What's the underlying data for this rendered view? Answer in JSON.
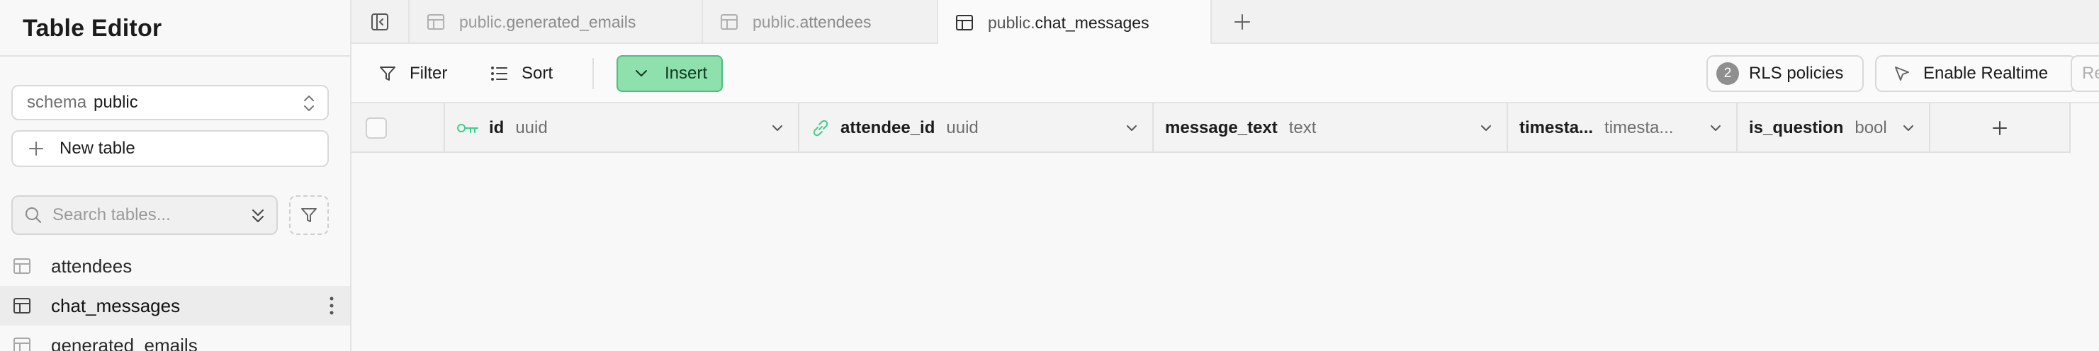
{
  "sidebar": {
    "title": "Table Editor",
    "schema": {
      "prefix": "schema",
      "value": "public"
    },
    "new_table_label": "New table",
    "search": {
      "placeholder": "Search tables..."
    },
    "tables": [
      {
        "name": "attendees",
        "active": false
      },
      {
        "name": "chat_messages",
        "active": true
      },
      {
        "name": "generated_emails",
        "active": false
      }
    ]
  },
  "tabs": [
    {
      "schema": "public.",
      "name": "generated_emails",
      "active": false
    },
    {
      "schema": "public.",
      "name": "attendees",
      "active": false
    },
    {
      "schema": "public.",
      "name": "chat_messages",
      "active": true
    }
  ],
  "toolbar": {
    "filter_label": "Filter",
    "sort_label": "Sort",
    "insert_label": "Insert",
    "rls_count": "2",
    "rls_label": "RLS policies",
    "realtime_label": "Enable Realtime",
    "cut_label": "Re"
  },
  "columns": [
    {
      "name": "id",
      "type": "uuid",
      "icon": "key-icon"
    },
    {
      "name": "attendee_id",
      "type": "uuid",
      "icon": "link-icon"
    },
    {
      "name": "message_text",
      "type": "text"
    },
    {
      "name": "timesta...",
      "type": "timesta..."
    },
    {
      "name": "is_question",
      "type": "bool"
    }
  ],
  "colors": {
    "accent_green": "#8ee0ad",
    "accent_green_border": "#4fbf7c",
    "key_icon_green": "#3ecf8e"
  }
}
